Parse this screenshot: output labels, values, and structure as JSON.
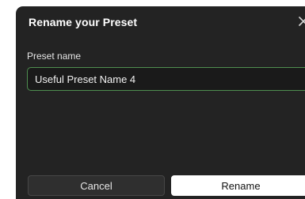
{
  "dialog": {
    "title": "Rename your Preset",
    "close_icon": "close-icon"
  },
  "field": {
    "label": "Preset name",
    "value": "Useful Preset Name 4"
  },
  "buttons": {
    "cancel_label": "Cancel",
    "rename_label": "Rename"
  },
  "colors": {
    "dialog_bg": "#232323",
    "input_bg": "#1a1a1a",
    "input_focus_border": "#4f8f50",
    "cancel_bg": "#2f2f2f",
    "rename_bg": "#ffffff"
  }
}
